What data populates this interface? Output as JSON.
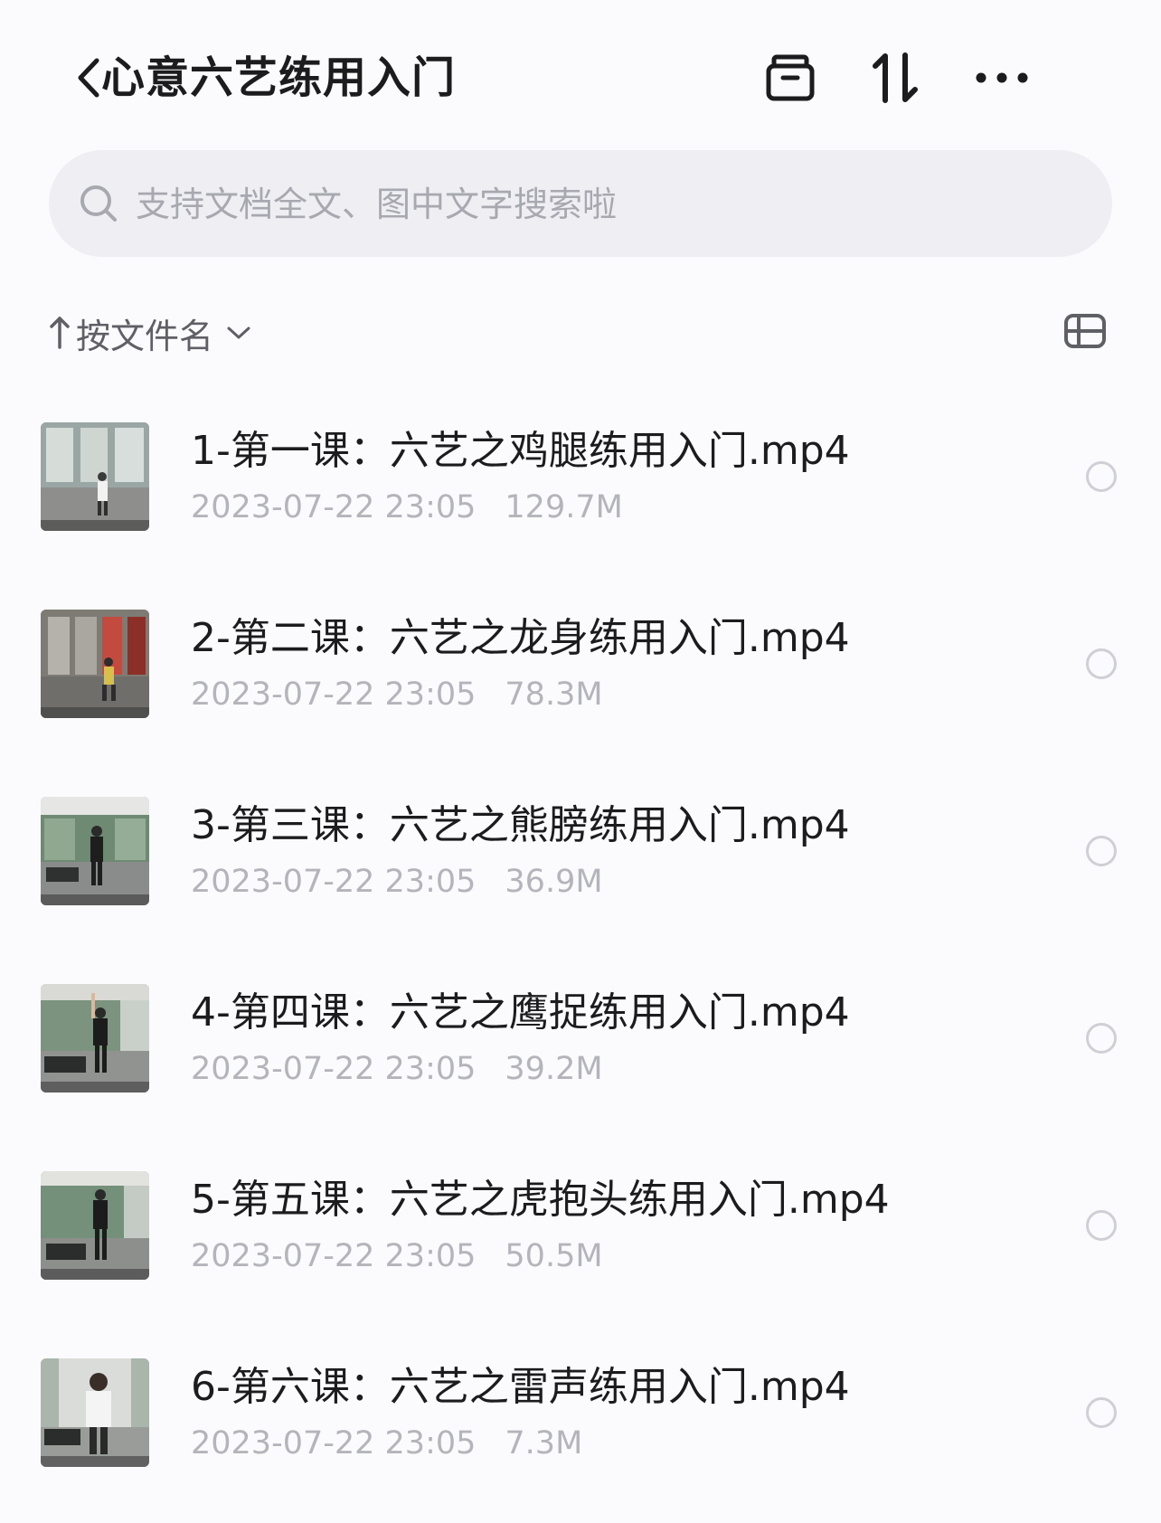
{
  "header": {
    "title": "心意六艺练用入门",
    "back_icon": "chevron-left-icon",
    "actions": [
      "archive-icon",
      "sort-icon",
      "more-icon"
    ]
  },
  "search": {
    "placeholder": "支持文档全文、图中文字搜索啦",
    "value": ""
  },
  "sort": {
    "label": "按文件名"
  },
  "files": [
    {
      "name": "1-第一课：六艺之鸡腿练用入门.mp4",
      "date": "2023-07-22 23:05",
      "size": "129.7M",
      "selected": false
    },
    {
      "name": "2-第二课：六艺之龙身练用入门.mp4",
      "date": "2023-07-22 23:05",
      "size": "78.3M",
      "selected": false
    },
    {
      "name": "3-第三课：六艺之熊膀练用入门.mp4",
      "date": "2023-07-22 23:05",
      "size": "36.9M",
      "selected": false
    },
    {
      "name": "4-第四课：六艺之鹰捉练用入门.mp4",
      "date": "2023-07-22 23:05",
      "size": "39.2M",
      "selected": false
    },
    {
      "name": "5-第五课：六艺之虎抱头练用入门.mp4",
      "date": "2023-07-22 23:05",
      "size": "50.5M",
      "selected": false
    },
    {
      "name": "6-第六课：六艺之雷声练用入门.mp4",
      "date": "2023-07-22 23:05",
      "size": "7.3M",
      "selected": false
    }
  ]
}
